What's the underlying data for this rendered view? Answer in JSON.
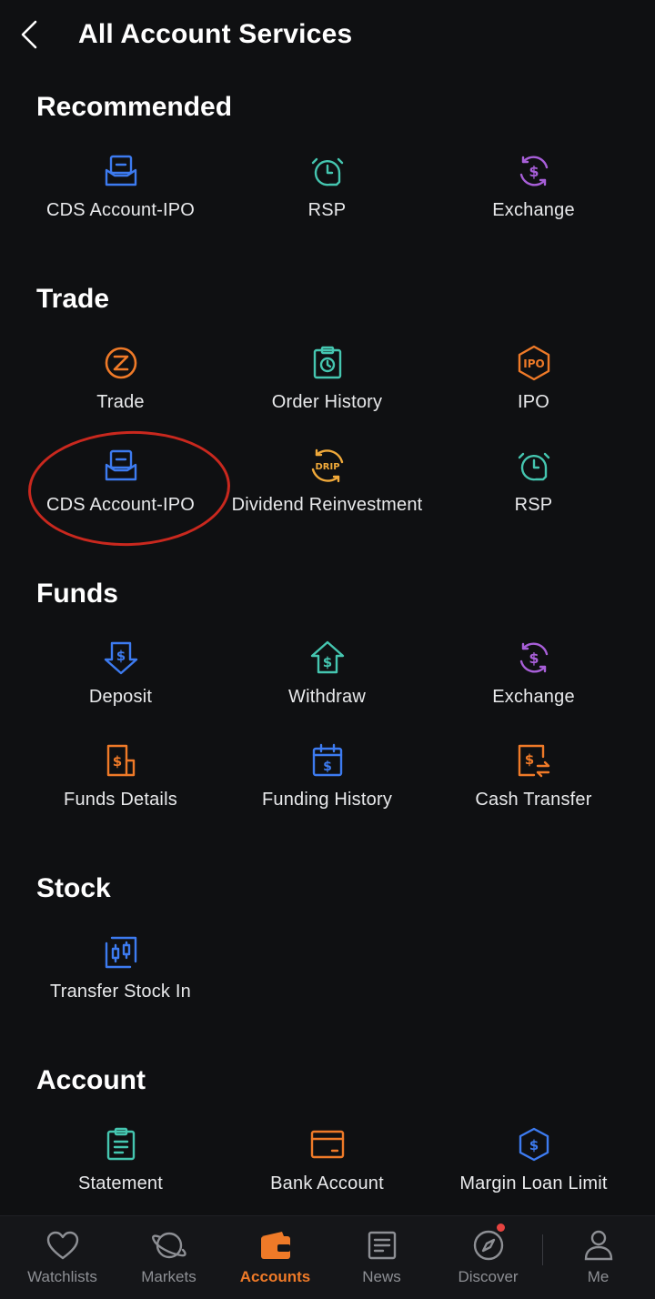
{
  "header": {
    "title": "All Account Services"
  },
  "colors": {
    "blue": "#3d7bf0",
    "teal": "#45c6b0",
    "purple": "#a85fd9",
    "orange": "#ef7a28",
    "gold": "#f0a93a",
    "annotation": "#c9281e"
  },
  "sections": {
    "recommended": {
      "title": "Recommended",
      "items": [
        {
          "label": "CDS Account-IPO",
          "icon": "cds-account-icon"
        },
        {
          "label": "RSP",
          "icon": "alarm-clock-icon"
        },
        {
          "label": "Exchange",
          "icon": "currency-exchange-icon"
        }
      ]
    },
    "trade": {
      "title": "Trade",
      "items": [
        {
          "label": "Trade",
          "icon": "trade-icon"
        },
        {
          "label": "Order History",
          "icon": "order-history-icon"
        },
        {
          "label": "IPO",
          "icon": "ipo-icon"
        },
        {
          "label": "CDS Account-IPO",
          "icon": "cds-account-icon"
        },
        {
          "label": "Dividend Reinvestment",
          "icon": "drip-icon"
        },
        {
          "label": "RSP",
          "icon": "alarm-clock-icon"
        }
      ]
    },
    "funds": {
      "title": "Funds",
      "items": [
        {
          "label": "Deposit",
          "icon": "deposit-icon"
        },
        {
          "label": "Withdraw",
          "icon": "withdraw-icon"
        },
        {
          "label": "Exchange",
          "icon": "currency-exchange-icon"
        },
        {
          "label": "Funds Details",
          "icon": "funds-details-icon"
        },
        {
          "label": "Funding History",
          "icon": "funding-history-icon"
        },
        {
          "label": "Cash Transfer",
          "icon": "cash-transfer-icon"
        }
      ]
    },
    "stock": {
      "title": "Stock",
      "items": [
        {
          "label": "Transfer Stock In",
          "icon": "transfer-stock-icon"
        }
      ]
    },
    "account": {
      "title": "Account",
      "items": [
        {
          "label": "Statement",
          "icon": "statement-icon"
        },
        {
          "label": "Bank Account",
          "icon": "bank-card-icon"
        },
        {
          "label": "Margin Loan Limit",
          "icon": "margin-shield-icon"
        }
      ]
    }
  },
  "nav": {
    "items": [
      {
        "label": "Watchlists",
        "icon": "heart-icon"
      },
      {
        "label": "Markets",
        "icon": "planet-icon"
      },
      {
        "label": "Accounts",
        "icon": "wallet-icon",
        "active": true
      },
      {
        "label": "News",
        "icon": "news-icon"
      },
      {
        "label": "Discover",
        "icon": "compass-icon",
        "badge": true
      },
      {
        "label": "Me",
        "icon": "person-icon"
      }
    ]
  }
}
